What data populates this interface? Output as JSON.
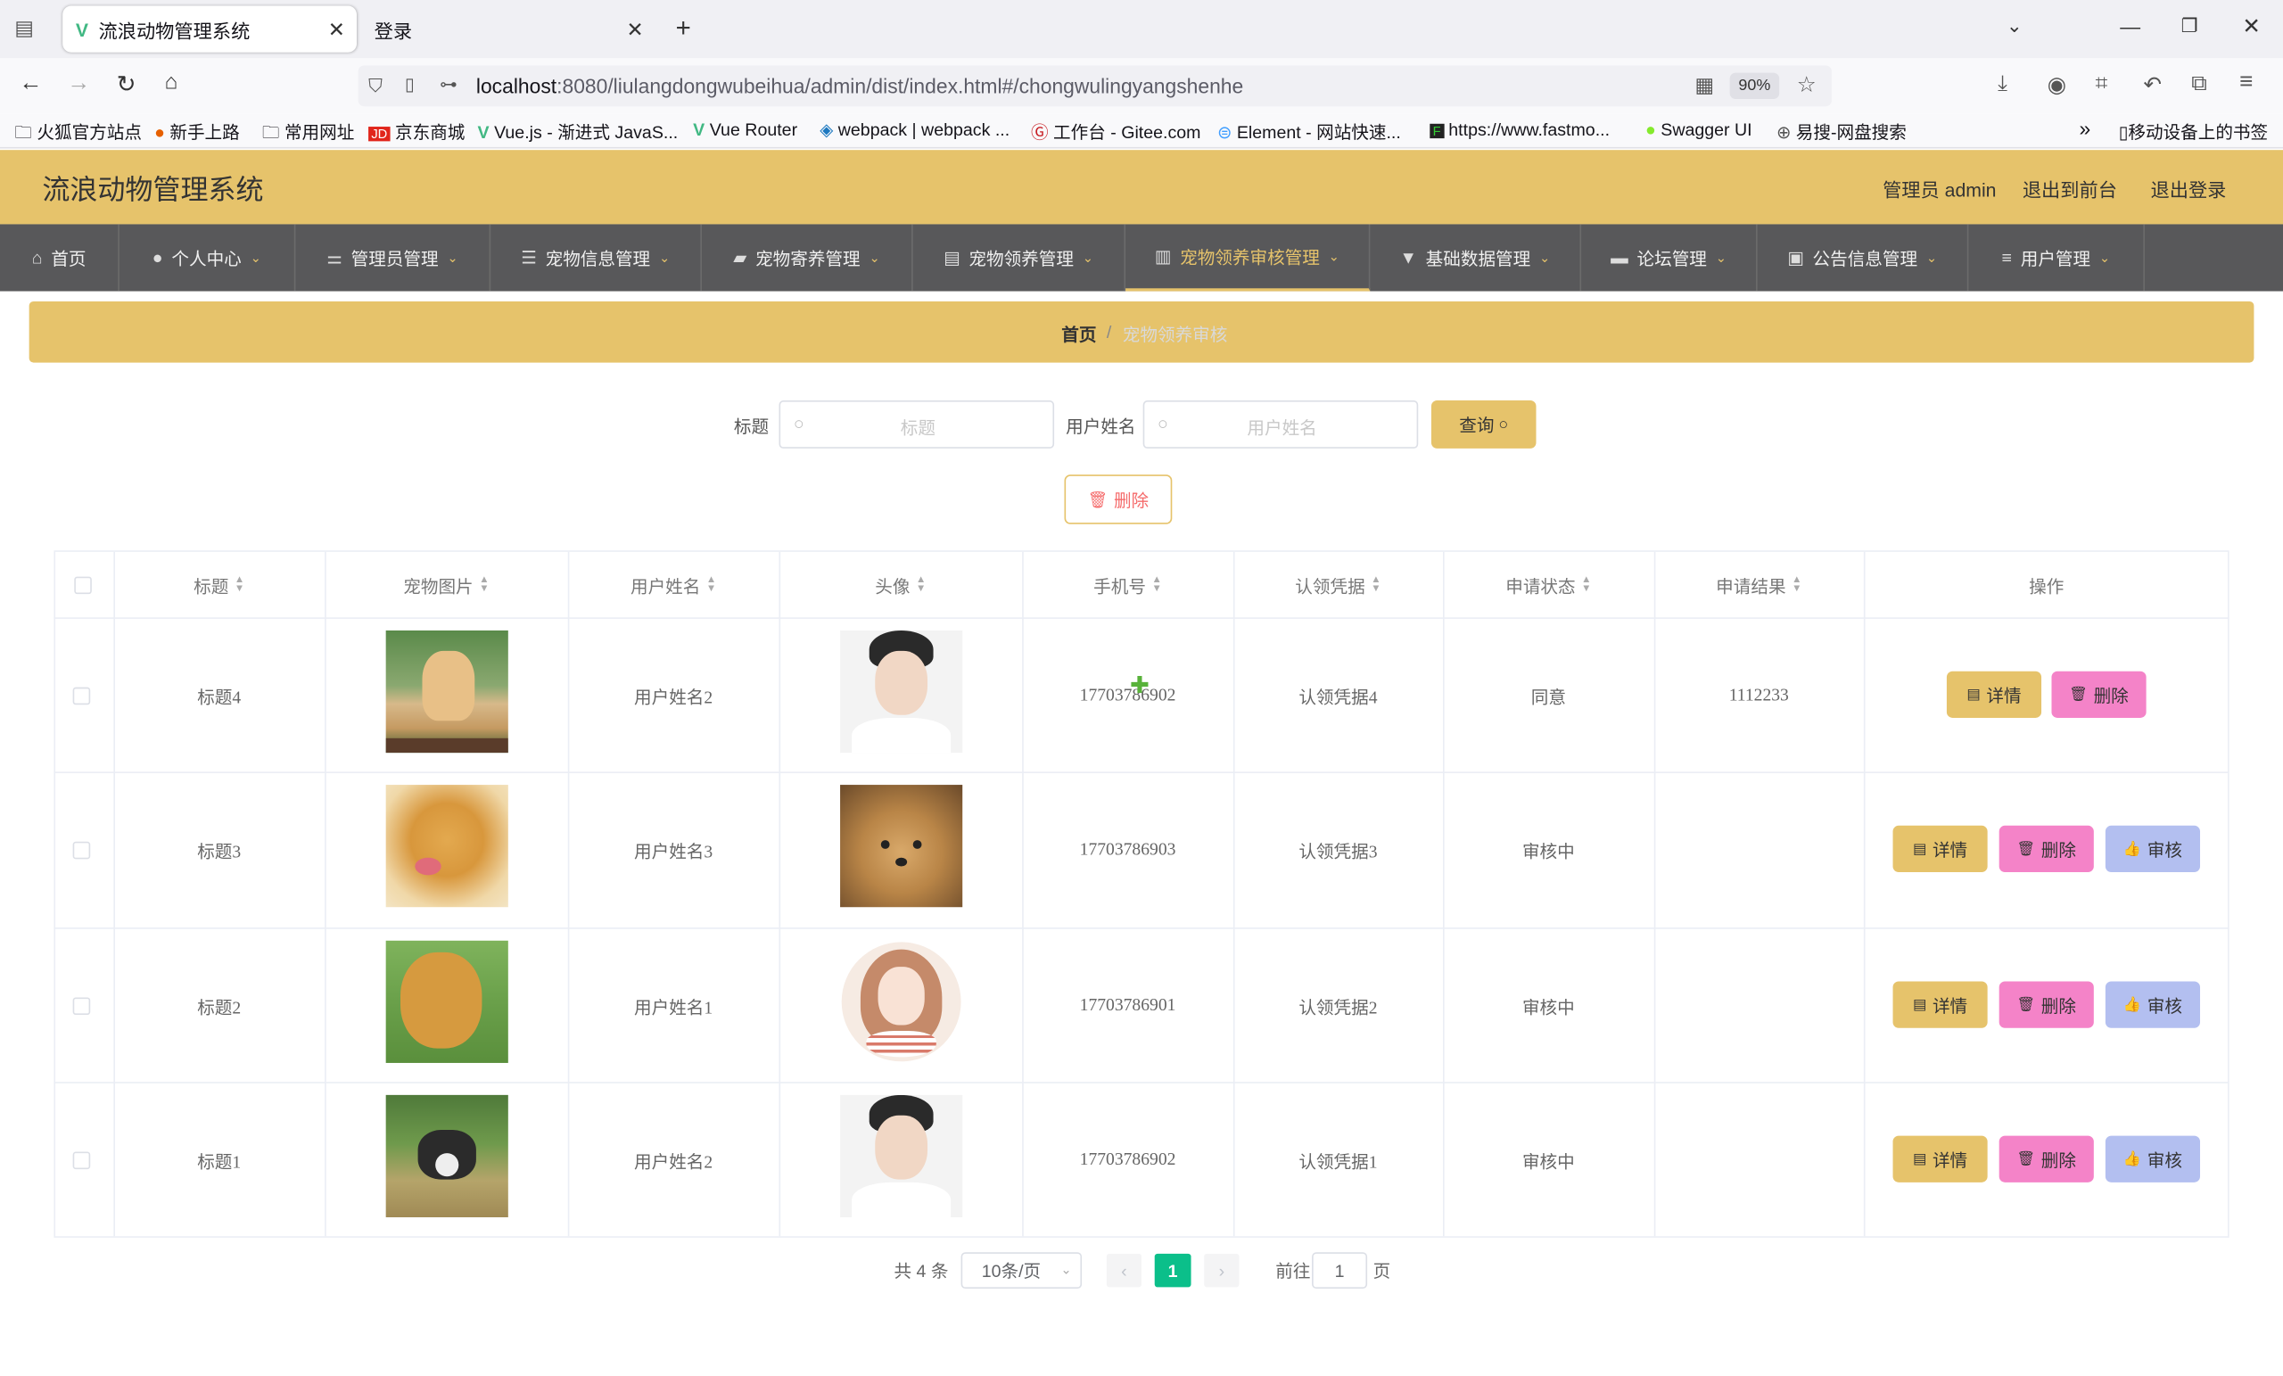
{
  "browser": {
    "tabs": [
      {
        "label": "流浪动物管理系统",
        "active": true
      },
      {
        "label": "登录",
        "active": false
      }
    ],
    "url_host": "localhost",
    "url_rest": ":8080/liulangdongwubeihua/admin/dist/index.html#/chongwulingyangshenhe",
    "zoom": "90%",
    "bookmarks": [
      "火狐官方站点",
      "新手上路",
      "常用网址",
      "京东商城",
      "Vue.js - 渐进式 JavaS...",
      "Vue Router",
      "webpack | webpack ...",
      "工作台 - Gitee.com",
      "Element - 网站快速...",
      "https://www.fastmo...",
      "Swagger UI",
      "易搜-网盘搜索"
    ],
    "mobile_bookmarks": "移动设备上的书签"
  },
  "app": {
    "title": "流浪动物管理系统",
    "user_label": "管理员 admin",
    "to_front": "退出到前台",
    "logout": "退出登录",
    "accent": "#e6c36b"
  },
  "nav": [
    {
      "label": "首页",
      "icon": "home-icon",
      "dropdown": false,
      "selected": false
    },
    {
      "label": "个人中心",
      "icon": "user-icon",
      "dropdown": true,
      "selected": false
    },
    {
      "label": "管理员管理",
      "icon": "sliders-icon",
      "dropdown": true,
      "selected": false
    },
    {
      "label": "宠物信息管理",
      "icon": "list-icon",
      "dropdown": true,
      "selected": false
    },
    {
      "label": "宠物寄养管理",
      "icon": "ticket-icon",
      "dropdown": true,
      "selected": false
    },
    {
      "label": "宠物领养管理",
      "icon": "clipboard-icon",
      "dropdown": true,
      "selected": false
    },
    {
      "label": "宠物领养审核管理",
      "icon": "document-icon",
      "dropdown": true,
      "selected": true
    },
    {
      "label": "基础数据管理",
      "icon": "stamp-icon",
      "dropdown": true,
      "selected": false
    },
    {
      "label": "论坛管理",
      "icon": "monitor-icon",
      "dropdown": true,
      "selected": false
    },
    {
      "label": "公告信息管理",
      "icon": "briefcase-icon",
      "dropdown": true,
      "selected": false
    },
    {
      "label": "用户管理",
      "icon": "menu-icon",
      "dropdown": true,
      "selected": false
    }
  ],
  "breadcrumb": {
    "home": "首页",
    "sep": "/",
    "current": "宠物领养审核"
  },
  "search": {
    "title_label": "标题",
    "title_placeholder": "标题",
    "name_label": "用户姓名",
    "name_placeholder": "用户姓名",
    "query_button": "查询"
  },
  "bulk_delete": "删除",
  "table": {
    "headers": [
      "标题",
      "宠物图片",
      "用户姓名",
      "头像",
      "手机号",
      "认领凭据",
      "申请状态",
      "申请结果",
      "操作"
    ],
    "rows": [
      {
        "title": "标题4",
        "pet_image": "corgi-photo",
        "user": "用户姓名2",
        "avatar": "man-portrait",
        "phone": "17703786902",
        "proof": "认领凭据4",
        "status": "同意",
        "result": "1112233",
        "actions": [
          "详情",
          "删除"
        ]
      },
      {
        "title": "标题3",
        "pet_image": "golden-retriever-photo",
        "user": "用户姓名3",
        "avatar": "puppy-portrait",
        "phone": "17703786903",
        "proof": "认领凭据3",
        "status": "审核中",
        "result": "",
        "actions": [
          "详情",
          "删除",
          "审核"
        ]
      },
      {
        "title": "标题2",
        "pet_image": "golden-retriever-lawn-photo",
        "user": "用户姓名1",
        "avatar": "woman-illustration",
        "phone": "17703786901",
        "proof": "认领凭据2",
        "status": "审核中",
        "result": "",
        "actions": [
          "详情",
          "删除",
          "审核"
        ]
      },
      {
        "title": "标题1",
        "pet_image": "husky-photo",
        "user": "用户姓名2",
        "avatar": "man-portrait",
        "phone": "17703786902",
        "proof": "认领凭据1",
        "status": "审核中",
        "result": "",
        "actions": [
          "详情",
          "删除",
          "审核"
        ]
      }
    ]
  },
  "pagination": {
    "total": "共 4 条",
    "page_size": "10条/页",
    "current": "1",
    "goto_label": "前往",
    "goto_value": "1",
    "page_suffix": "页"
  }
}
